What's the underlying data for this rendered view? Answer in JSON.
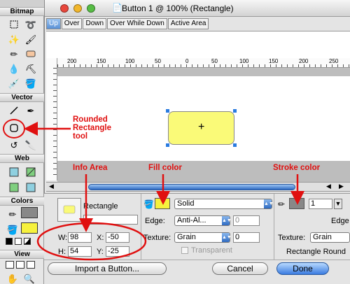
{
  "toolbox": {
    "sections": [
      "Bitmap",
      "Vector",
      "Web",
      "Colors",
      "View"
    ]
  },
  "window": {
    "title": "Button 1 @ 100% (Rectangle)",
    "tabs": [
      "Up",
      "Over",
      "Down",
      "Over While Down",
      "Active Area"
    ],
    "ruler_labels": [
      "200",
      "150",
      "100",
      "50",
      "0",
      "50",
      "100",
      "150",
      "200",
      "250"
    ],
    "canvas_shape": {
      "kind": "rounded-rectangle",
      "fill": "#fafa78",
      "center_mark": "+"
    }
  },
  "inspector": {
    "object_type": "Rectangle",
    "width_label": "W:",
    "width_value": "98",
    "height_label": "H:",
    "height_value": "54",
    "x_label": "X:",
    "x_value": "-50",
    "y_label": "Y:",
    "y_value": "-25",
    "fill_select": "Solid",
    "edge_label": "Edge:",
    "edge_select": "Anti-Al...",
    "edge_value": "0",
    "texture_label": "Texture:",
    "texture_select": "Grain",
    "texture_value": "0",
    "transparent_label": "Transparent",
    "stroke_size": "1",
    "stroke_edge_label": "Edge",
    "stroke_texture_label": "Texture:",
    "stroke_texture_select": "Grain",
    "rectangle_round_label": "Rectangle Round"
  },
  "buttons": {
    "import": "Import a Button...",
    "cancel": "Cancel",
    "done": "Done"
  },
  "annotations": {
    "rounded_rect_tool": [
      "Rounded",
      "Rectangle",
      "tool"
    ],
    "info_area": "Info Area",
    "fill_color": "Fill color",
    "stroke_color": "Stroke color"
  },
  "colors": {
    "fill": "#fafa78",
    "annotation": "#e01010",
    "accent": "#3a7be0"
  }
}
